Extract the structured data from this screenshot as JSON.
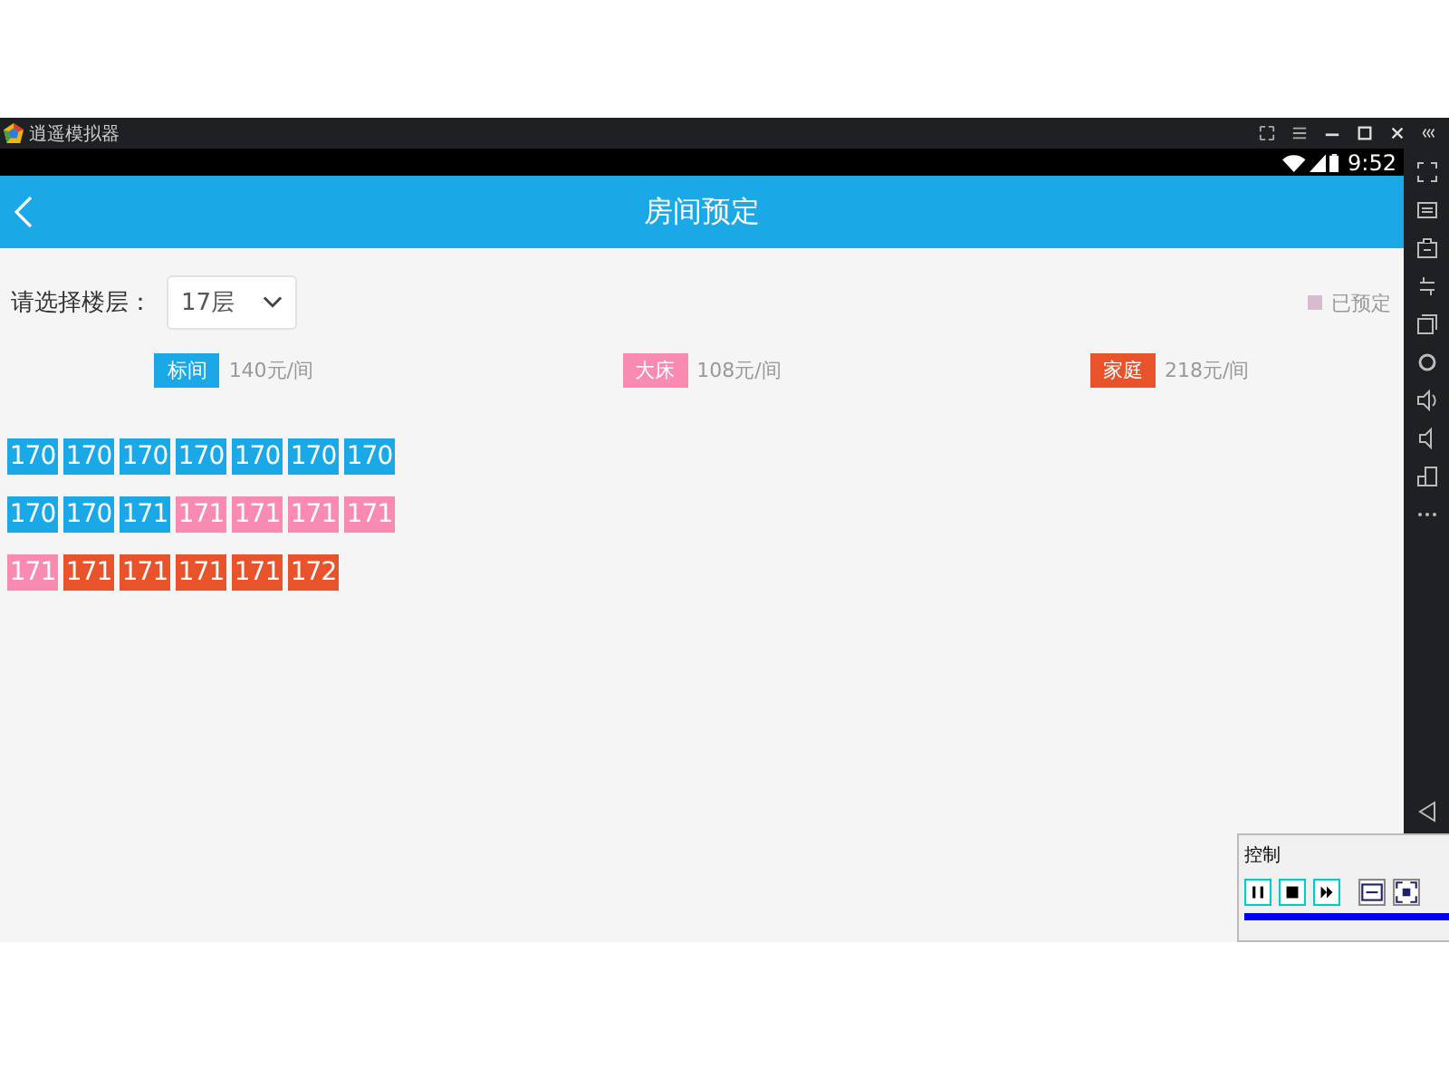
{
  "emulator": {
    "title": "逍遥模拟器"
  },
  "status_bar": {
    "time": "9:52"
  },
  "app_bar": {
    "title": "房间预定"
  },
  "floor_select": {
    "label": "请选择楼层：",
    "value": "17层"
  },
  "booked_legend": {
    "label": "已预定",
    "color": "#d7bcd0"
  },
  "room_types": [
    {
      "label": "标间",
      "price": "140元/间",
      "color": "#1aa8e6"
    },
    {
      "label": "大床",
      "price": "108元/间",
      "color": "#f98bb3"
    },
    {
      "label": "家庭",
      "price": "218元/间",
      "color": "#e8532b"
    }
  ],
  "room_rows": [
    {
      "rooms": [
        {
          "number": "170",
          "color": "#1aa8e6"
        },
        {
          "number": "170",
          "color": "#1aa8e6"
        },
        {
          "number": "170",
          "color": "#1aa8e6"
        },
        {
          "number": "170",
          "color": "#1aa8e6"
        },
        {
          "number": "170",
          "color": "#1aa8e6"
        },
        {
          "number": "170",
          "color": "#1aa8e6"
        },
        {
          "number": "170",
          "color": "#1aa8e6"
        }
      ]
    },
    {
      "rooms": [
        {
          "number": "170",
          "color": "#1aa8e6"
        },
        {
          "number": "170",
          "color": "#1aa8e6"
        },
        {
          "number": "171",
          "color": "#1aa8e6"
        },
        {
          "number": "171",
          "color": "#f98bb3"
        },
        {
          "number": "171",
          "color": "#f98bb3"
        },
        {
          "number": "171",
          "color": "#f98bb3"
        },
        {
          "number": "171",
          "color": "#f98bb3"
        }
      ]
    },
    {
      "rooms": [
        {
          "number": "171",
          "color": "#f98bb3"
        },
        {
          "number": "171",
          "color": "#e8532b"
        },
        {
          "number": "171",
          "color": "#e8532b"
        },
        {
          "number": "171",
          "color": "#e8532b"
        },
        {
          "number": "171",
          "color": "#e8532b"
        },
        {
          "number": "172",
          "color": "#e8532b"
        }
      ]
    }
  ],
  "control_window": {
    "title": "控制"
  }
}
